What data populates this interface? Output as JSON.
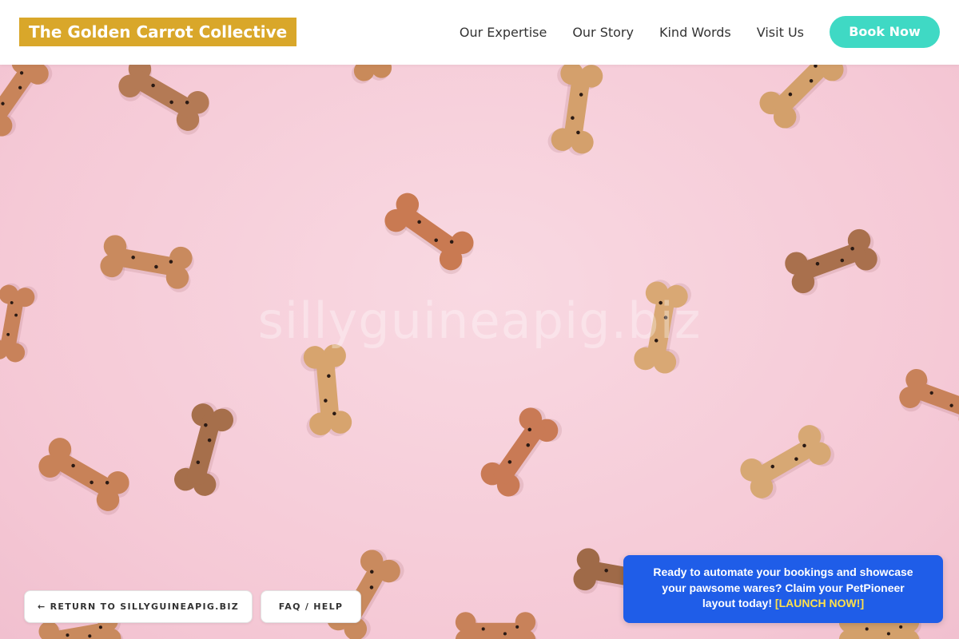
{
  "header": {
    "logo_text": "The Golden Carrot Collective",
    "nav": [
      {
        "label": "Our Expertise"
      },
      {
        "label": "Our Story"
      },
      {
        "label": "Kind Words"
      },
      {
        "label": "Visit Us"
      }
    ],
    "cta_label": "Book Now"
  },
  "hero": {
    "watermark": "sillyguineapig.biz",
    "image_description_icon": "dog-bone-treats-pattern"
  },
  "footer_actions": {
    "return_label": "← RETURN TO SILLYGUINEAPIG.BIZ",
    "faq_label": "FAQ / HELP"
  },
  "promo": {
    "text": "Ready to automate your bookings and showcase your pawsome wares? Claim your PetPioneer layout today!",
    "link_label": "[LAUNCH NOW!]"
  },
  "colors": {
    "logo_bg": "#d9a72a",
    "cta_bg": "#3fd9c4",
    "promo_bg": "#1f5de8",
    "promo_link": "#ffe14a",
    "hero_bg": "#f7cfda"
  }
}
